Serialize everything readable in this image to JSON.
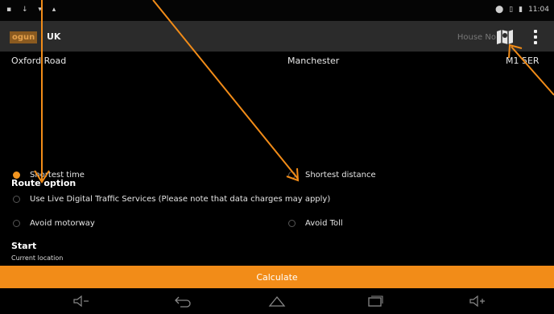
{
  "status": {
    "clock": "11:04"
  },
  "toolbar": {
    "logo": "ogun",
    "country": "UK",
    "house_placeholder": "House No"
  },
  "address": {
    "street": "Oxford Road",
    "city": "Manchester",
    "postcode": "M1 5ER"
  },
  "route": {
    "title": "Route option",
    "options": [
      {
        "label": "Shortest time",
        "selected": true
      },
      {
        "label": "Shortest distance",
        "selected": false
      },
      {
        "label": "Use Live Digital Traffic Services (Please note that data charges may apply)",
        "selected": false
      },
      {
        "label": "Avoid motorway",
        "selected": false
      },
      {
        "label": "Avoid Toll",
        "selected": false
      }
    ]
  },
  "start": {
    "title": "Start",
    "value": "Current location"
  },
  "calculate_label": "Calculate",
  "colors": {
    "accent": "#f28c18",
    "toolbar": "#2b2b2b",
    "annotation": "#f28c18"
  },
  "nav_icons": [
    "volume-down-icon",
    "back-icon",
    "home-icon",
    "recent-apps-icon",
    "volume-up-icon"
  ]
}
